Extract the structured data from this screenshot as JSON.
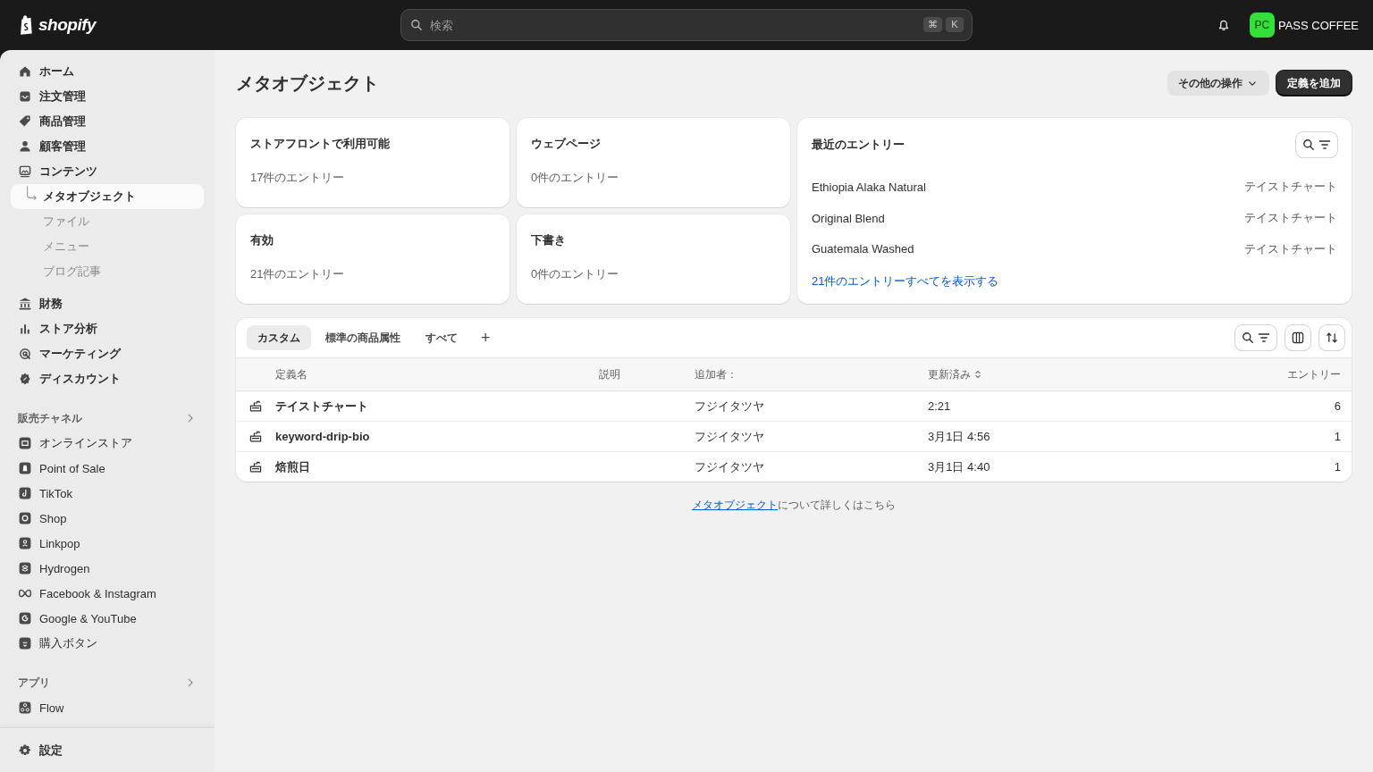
{
  "topbar": {
    "logo": "shopify",
    "search": {
      "placeholder": "検索"
    },
    "shortcut_keys": [
      "⌘",
      "K"
    ],
    "store": {
      "initials": "PC",
      "name": "PASS COFFEE"
    }
  },
  "sidebar": {
    "main_items": [
      {
        "label": "ホーム",
        "selected": false
      },
      {
        "label": "注文管理",
        "selected": false
      },
      {
        "label": "商品管理",
        "selected": false
      },
      {
        "label": "顧客管理",
        "selected": false
      },
      {
        "label": "コンテンツ",
        "selected": false,
        "children": [
          {
            "label": "メタオブジェクト",
            "selected": true
          },
          {
            "label": "ファイル",
            "selected": false
          },
          {
            "label": "メニュー",
            "selected": false
          },
          {
            "label": "ブログ記事",
            "selected": false
          }
        ]
      },
      {
        "label": "財務",
        "selected": false
      },
      {
        "label": "ストア分析",
        "selected": false
      },
      {
        "label": "マーケティング",
        "selected": false
      },
      {
        "label": "ディスカウント",
        "selected": false
      }
    ],
    "sales_channels": {
      "title": "販売チャネル",
      "items": [
        {
          "label": "オンラインストア",
          "selected": false
        },
        {
          "label": "Point of Sale",
          "selected": false
        },
        {
          "label": "TikTok",
          "selected": false
        },
        {
          "label": "Shop",
          "selected": false
        },
        {
          "label": "Linkpop",
          "selected": false
        },
        {
          "label": "Hydrogen",
          "selected": false
        },
        {
          "label": "Facebook & Instagram",
          "selected": false
        },
        {
          "label": "Google & YouTube",
          "selected": false
        },
        {
          "label": "購入ボタン",
          "selected": false
        }
      ]
    },
    "apps": {
      "title": "アプリ",
      "items": [
        {
          "label": "Flow",
          "selected": false
        }
      ]
    },
    "settings": "設定"
  },
  "page": {
    "title": "メタオブジェクト",
    "actions": {
      "more": "その他の操作",
      "primary": "定義を追加"
    },
    "stat_cards": [
      {
        "title": "ストアフロントで利用可能",
        "entries": "17件のエントリー"
      },
      {
        "title": "ウェブページ",
        "entries": "0件のエントリー"
      },
      {
        "title": "有効",
        "entries": "21件のエントリー"
      },
      {
        "title": "下書き",
        "entries": "0件のエントリー"
      }
    ],
    "recent": {
      "title": "最近のエントリー",
      "entries": [
        {
          "name": "Ethiopia Alaka Natural",
          "type": "テイストチャート"
        },
        {
          "name": "Original Blend",
          "type": "テイストチャート"
        },
        {
          "name": "Guatemala Washed",
          "type": "テイストチャート"
        }
      ],
      "link": "21件のエントリーすべてを表示する"
    },
    "tabs": [
      {
        "label": "カスタム",
        "selected": true
      },
      {
        "label": "標準の商品属性",
        "selected": false
      },
      {
        "label": "すべて",
        "selected": false
      }
    ],
    "add_tab": "+",
    "table": {
      "columns": [
        {
          "label": "定義名",
          "sortable": false
        },
        {
          "label": "説明",
          "sortable": false
        },
        {
          "label": "追加者：",
          "sortable": false
        },
        {
          "label": "更新済み",
          "sortable": true
        },
        {
          "label": "エントリー",
          "sortable": false
        }
      ],
      "rows": [
        {
          "name": "テイストチャート",
          "added_by": "フジイタツヤ",
          "updated": "2:21",
          "entries": "6"
        },
        {
          "name": "keyword-drip-bio",
          "added_by": "フジイタツヤ",
          "updated": "3月1日 4:56",
          "entries": "1"
        },
        {
          "name": "焙煎日",
          "added_by": "フジイタツヤ",
          "updated": "3月1日 4:40",
          "entries": "1"
        }
      ]
    },
    "help": {
      "link": "メタオブジェクト",
      "text": "について詳しくはこちら"
    }
  }
}
